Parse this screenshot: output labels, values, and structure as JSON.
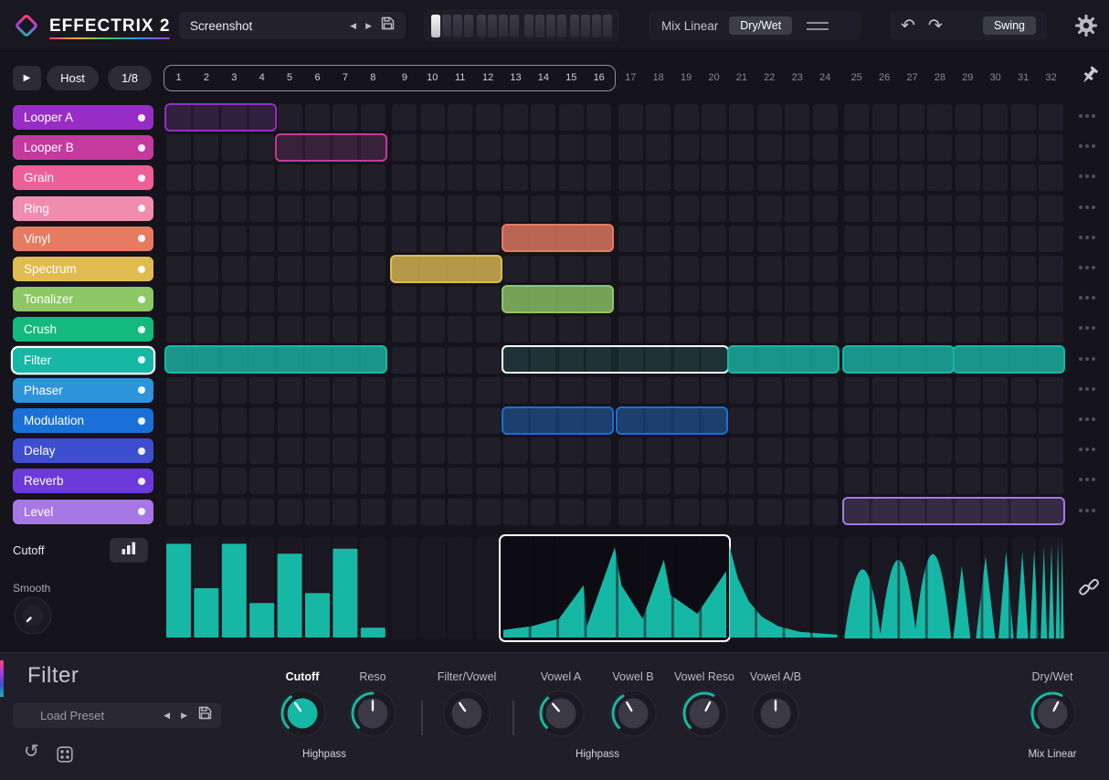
{
  "header": {
    "logo_text": "EFFECTRIX 2",
    "preset_name": "Screenshot",
    "mix_label": "Mix Linear",
    "drywet_label": "Dry/Wet",
    "swing_label": "Swing",
    "pattern_slots": {
      "count": 16,
      "active_index": 0
    }
  },
  "seq_header": {
    "host_label": "Host",
    "rate_label": "1/8",
    "total_steps": 32,
    "loop_steps": 16
  },
  "effects": [
    {
      "name": "Looper A",
      "color": "#982dc6"
    },
    {
      "name": "Looper B",
      "color": "#c53a9e"
    },
    {
      "name": "Grain",
      "color": "#ee5f9a"
    },
    {
      "name": "Ring",
      "color": "#f08cae"
    },
    {
      "name": "Vinyl",
      "color": "#e67b61"
    },
    {
      "name": "Spectrum",
      "color": "#dfbb51"
    },
    {
      "name": "Tonalizer",
      "color": "#8ec765"
    },
    {
      "name": "Crush",
      "color": "#14b97e"
    },
    {
      "name": "Filter",
      "color": "#17b7a5",
      "selected": true
    },
    {
      "name": "Phaser",
      "color": "#2e94da"
    },
    {
      "name": "Modulation",
      "color": "#1a70d6"
    },
    {
      "name": "Delay",
      "color": "#3e4ed0"
    },
    {
      "name": "Reverb",
      "color": "#6c3ada"
    },
    {
      "name": "Level",
      "color": "#a678e6"
    }
  ],
  "blocks": [
    {
      "row": 0,
      "start": 1,
      "len": 4,
      "style": "outline"
    },
    {
      "row": 1,
      "start": 5,
      "len": 4,
      "style": "outline"
    },
    {
      "row": 4,
      "start": 13,
      "len": 4,
      "style": "filled"
    },
    {
      "row": 5,
      "start": 9,
      "len": 4,
      "style": "filled"
    },
    {
      "row": 6,
      "start": 13,
      "len": 4,
      "style": "filled"
    },
    {
      "row": 8,
      "start": 1,
      "len": 8,
      "style": "filled"
    },
    {
      "row": 8,
      "start": 13,
      "len": 8,
      "style": "selected"
    },
    {
      "row": 8,
      "start": 21,
      "len": 4,
      "style": "filled"
    },
    {
      "row": 8,
      "start": 25,
      "len": 4,
      "style": "filled"
    },
    {
      "row": 8,
      "start": 29,
      "len": 4,
      "style": "filled"
    },
    {
      "row": 10,
      "start": 13,
      "len": 4,
      "style": "semi"
    },
    {
      "row": 10,
      "start": 17,
      "len": 4,
      "style": "semi"
    },
    {
      "row": 13,
      "start": 25,
      "len": 8,
      "style": "outline"
    }
  ],
  "left_controls": {
    "cutoff_label": "Cutoff",
    "smooth_label": "Smooth"
  },
  "sequencer": {
    "bars_region": {
      "start": 1,
      "end": 8,
      "values": [
        0.95,
        0.5,
        0.95,
        0.35,
        0.85,
        0.45,
        0.9,
        0.1
      ]
    },
    "selected_region": {
      "start": 13,
      "end": 20
    },
    "saw_region": {
      "start": 13,
      "end": 20,
      "points": [
        [
          0,
          0.08
        ],
        [
          0.13,
          0.12
        ],
        [
          0.25,
          0.2
        ],
        [
          0.36,
          0.55
        ],
        [
          0.375,
          0.12
        ],
        [
          0.5,
          0.95
        ],
        [
          0.53,
          0.55
        ],
        [
          0.625,
          0.2
        ],
        [
          0.72,
          0.82
        ],
        [
          0.75,
          0.45
        ],
        [
          0.87,
          0.25
        ],
        [
          1,
          0.7
        ]
      ]
    },
    "decay_region": {
      "start": 21,
      "end": 24,
      "points": [
        [
          0,
          0.97
        ],
        [
          0.08,
          0.62
        ],
        [
          0.18,
          0.38
        ],
        [
          0.3,
          0.22
        ],
        [
          0.45,
          0.12
        ],
        [
          0.65,
          0.06
        ],
        [
          1,
          0.03
        ]
      ]
    },
    "bumps_region": {
      "start": 25,
      "end": 28,
      "bumps": [
        {
          "c": 0.17,
          "h": 0.72,
          "w": 0.34
        },
        {
          "c": 0.5,
          "h": 0.82,
          "w": 0.34
        },
        {
          "c": 0.82,
          "h": 0.88,
          "w": 0.34
        }
      ]
    },
    "spikes_region": {
      "start": 29,
      "end": 32,
      "spikes": [
        {
          "c": 0.06,
          "h": 0.75,
          "w": 0.16
        },
        {
          "c": 0.28,
          "h": 0.85,
          "w": 0.18
        },
        {
          "c": 0.47,
          "h": 0.9,
          "w": 0.14
        },
        {
          "c": 0.62,
          "h": 0.9,
          "w": 0.11
        },
        {
          "c": 0.73,
          "h": 0.92,
          "w": 0.08
        },
        {
          "c": 0.82,
          "h": 0.95,
          "w": 0.06
        },
        {
          "c": 0.89,
          "h": 0.97,
          "w": 0.05
        },
        {
          "c": 0.95,
          "h": 1,
          "w": 0.04
        },
        {
          "c": 0.99,
          "h": 1,
          "w": 0.03
        }
      ]
    }
  },
  "bottom_panel": {
    "title": "Filter",
    "load_preset_label": "Load Preset",
    "knobs": [
      {
        "label": "Cutoff",
        "value": 0.37,
        "filled": true,
        "arc": true
      },
      {
        "label": "Reso",
        "value": 0.5,
        "arc": true
      },
      {
        "label": "Filter/Vowel",
        "value": 0.37,
        "arc": false
      },
      {
        "label": "Vowel A",
        "value": 0.35,
        "arc": true
      },
      {
        "label": "Vowel B",
        "value": 0.39,
        "arc": true
      },
      {
        "label": "Vowel Reso",
        "value": 0.6,
        "arc": true
      },
      {
        "label": "Vowel A/B",
        "value": 0.5,
        "arc": false
      },
      {
        "label": "Dry/Wet",
        "value": 0.6,
        "arc": true
      }
    ],
    "filter_type": "Highpass",
    "vowel_type": "Highpass",
    "mix_mode": "Mix Linear"
  },
  "colors": {
    "accent": "#17b7a5",
    "panel": "#201f29",
    "cell": "#201e29"
  }
}
